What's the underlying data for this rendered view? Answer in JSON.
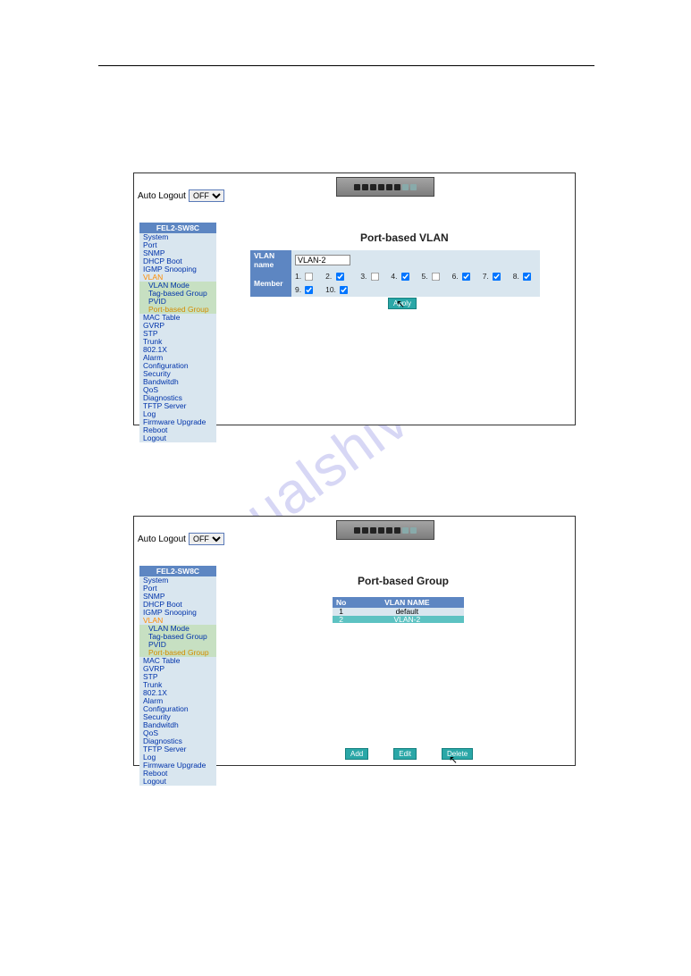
{
  "watermark": "manualshive.com",
  "topApp": {
    "autoLogoutLabel": "Auto Logout",
    "autoLogoutValue": "OFF",
    "sidebarTitle": "FEL2-SW8C",
    "menu": [
      {
        "label": "System"
      },
      {
        "label": "Port"
      },
      {
        "label": "SNMP"
      },
      {
        "label": "DHCP Boot"
      },
      {
        "label": "IGMP Snooping"
      },
      {
        "label": "VLAN",
        "activeParent": true
      },
      {
        "label": "VLAN Mode",
        "sub": true
      },
      {
        "label": "Tag-based Group",
        "sub": true
      },
      {
        "label": "PVID",
        "sub": true
      },
      {
        "label": "Port-based Group",
        "sub": true,
        "active": true
      },
      {
        "label": "MAC Table"
      },
      {
        "label": "GVRP"
      },
      {
        "label": "STP"
      },
      {
        "label": "Trunk"
      },
      {
        "label": "802.1X"
      },
      {
        "label": "Alarm"
      },
      {
        "label": "Configuration"
      },
      {
        "label": "Security"
      },
      {
        "label": "Bandwitdh"
      },
      {
        "label": "QoS"
      },
      {
        "label": "Diagnostics"
      },
      {
        "label": "TFTP Server"
      },
      {
        "label": "Log"
      },
      {
        "label": "Firmware Upgrade"
      },
      {
        "label": "Reboot"
      },
      {
        "label": "Logout"
      }
    ],
    "panelTitle": "Port-based VLAN",
    "vlanNameLabel": "VLAN name",
    "vlanNameValue": "VLAN-2",
    "memberLabel": "Member",
    "ports": [
      {
        "n": "1.",
        "c": false
      },
      {
        "n": "2.",
        "c": true
      },
      {
        "n": "3.",
        "c": false
      },
      {
        "n": "4.",
        "c": true
      },
      {
        "n": "5.",
        "c": false
      },
      {
        "n": "6.",
        "c": true
      },
      {
        "n": "7.",
        "c": true
      },
      {
        "n": "8.",
        "c": true
      },
      {
        "n": "9.",
        "c": true
      },
      {
        "n": "10.",
        "c": true
      }
    ],
    "applyLabel": "Apply"
  },
  "bottomApp": {
    "autoLogoutLabel": "Auto Logout",
    "autoLogoutValue": "OFF",
    "sidebarTitle": "FEL2-SW8C",
    "menu": [
      {
        "label": "System"
      },
      {
        "label": "Port"
      },
      {
        "label": "SNMP"
      },
      {
        "label": "DHCP Boot"
      },
      {
        "label": "IGMP Snooping"
      },
      {
        "label": "VLAN",
        "activeParent": true
      },
      {
        "label": "VLAN Mode",
        "sub": true
      },
      {
        "label": "Tag-based Group",
        "sub": true
      },
      {
        "label": "PVID",
        "sub": true
      },
      {
        "label": "Port-based Group",
        "sub": true,
        "active": true
      },
      {
        "label": "MAC Table"
      },
      {
        "label": "GVRP"
      },
      {
        "label": "STP"
      },
      {
        "label": "Trunk"
      },
      {
        "label": "802.1X"
      },
      {
        "label": "Alarm"
      },
      {
        "label": "Configuration"
      },
      {
        "label": "Security"
      },
      {
        "label": "Bandwitdh"
      },
      {
        "label": "QoS"
      },
      {
        "label": "Diagnostics"
      },
      {
        "label": "TFTP Server"
      },
      {
        "label": "Log"
      },
      {
        "label": "Firmware Upgrade"
      },
      {
        "label": "Reboot"
      },
      {
        "label": "Logout"
      }
    ],
    "panelTitle": "Port-based Group",
    "table": {
      "headers": [
        "No",
        "VLAN NAME"
      ],
      "rows": [
        {
          "no": "1",
          "name": "default",
          "selected": false
        },
        {
          "no": "2",
          "name": "VLAN-2",
          "selected": true
        }
      ]
    },
    "buttons": {
      "add": "Add",
      "edit": "Edit",
      "delete": "Delete"
    }
  }
}
